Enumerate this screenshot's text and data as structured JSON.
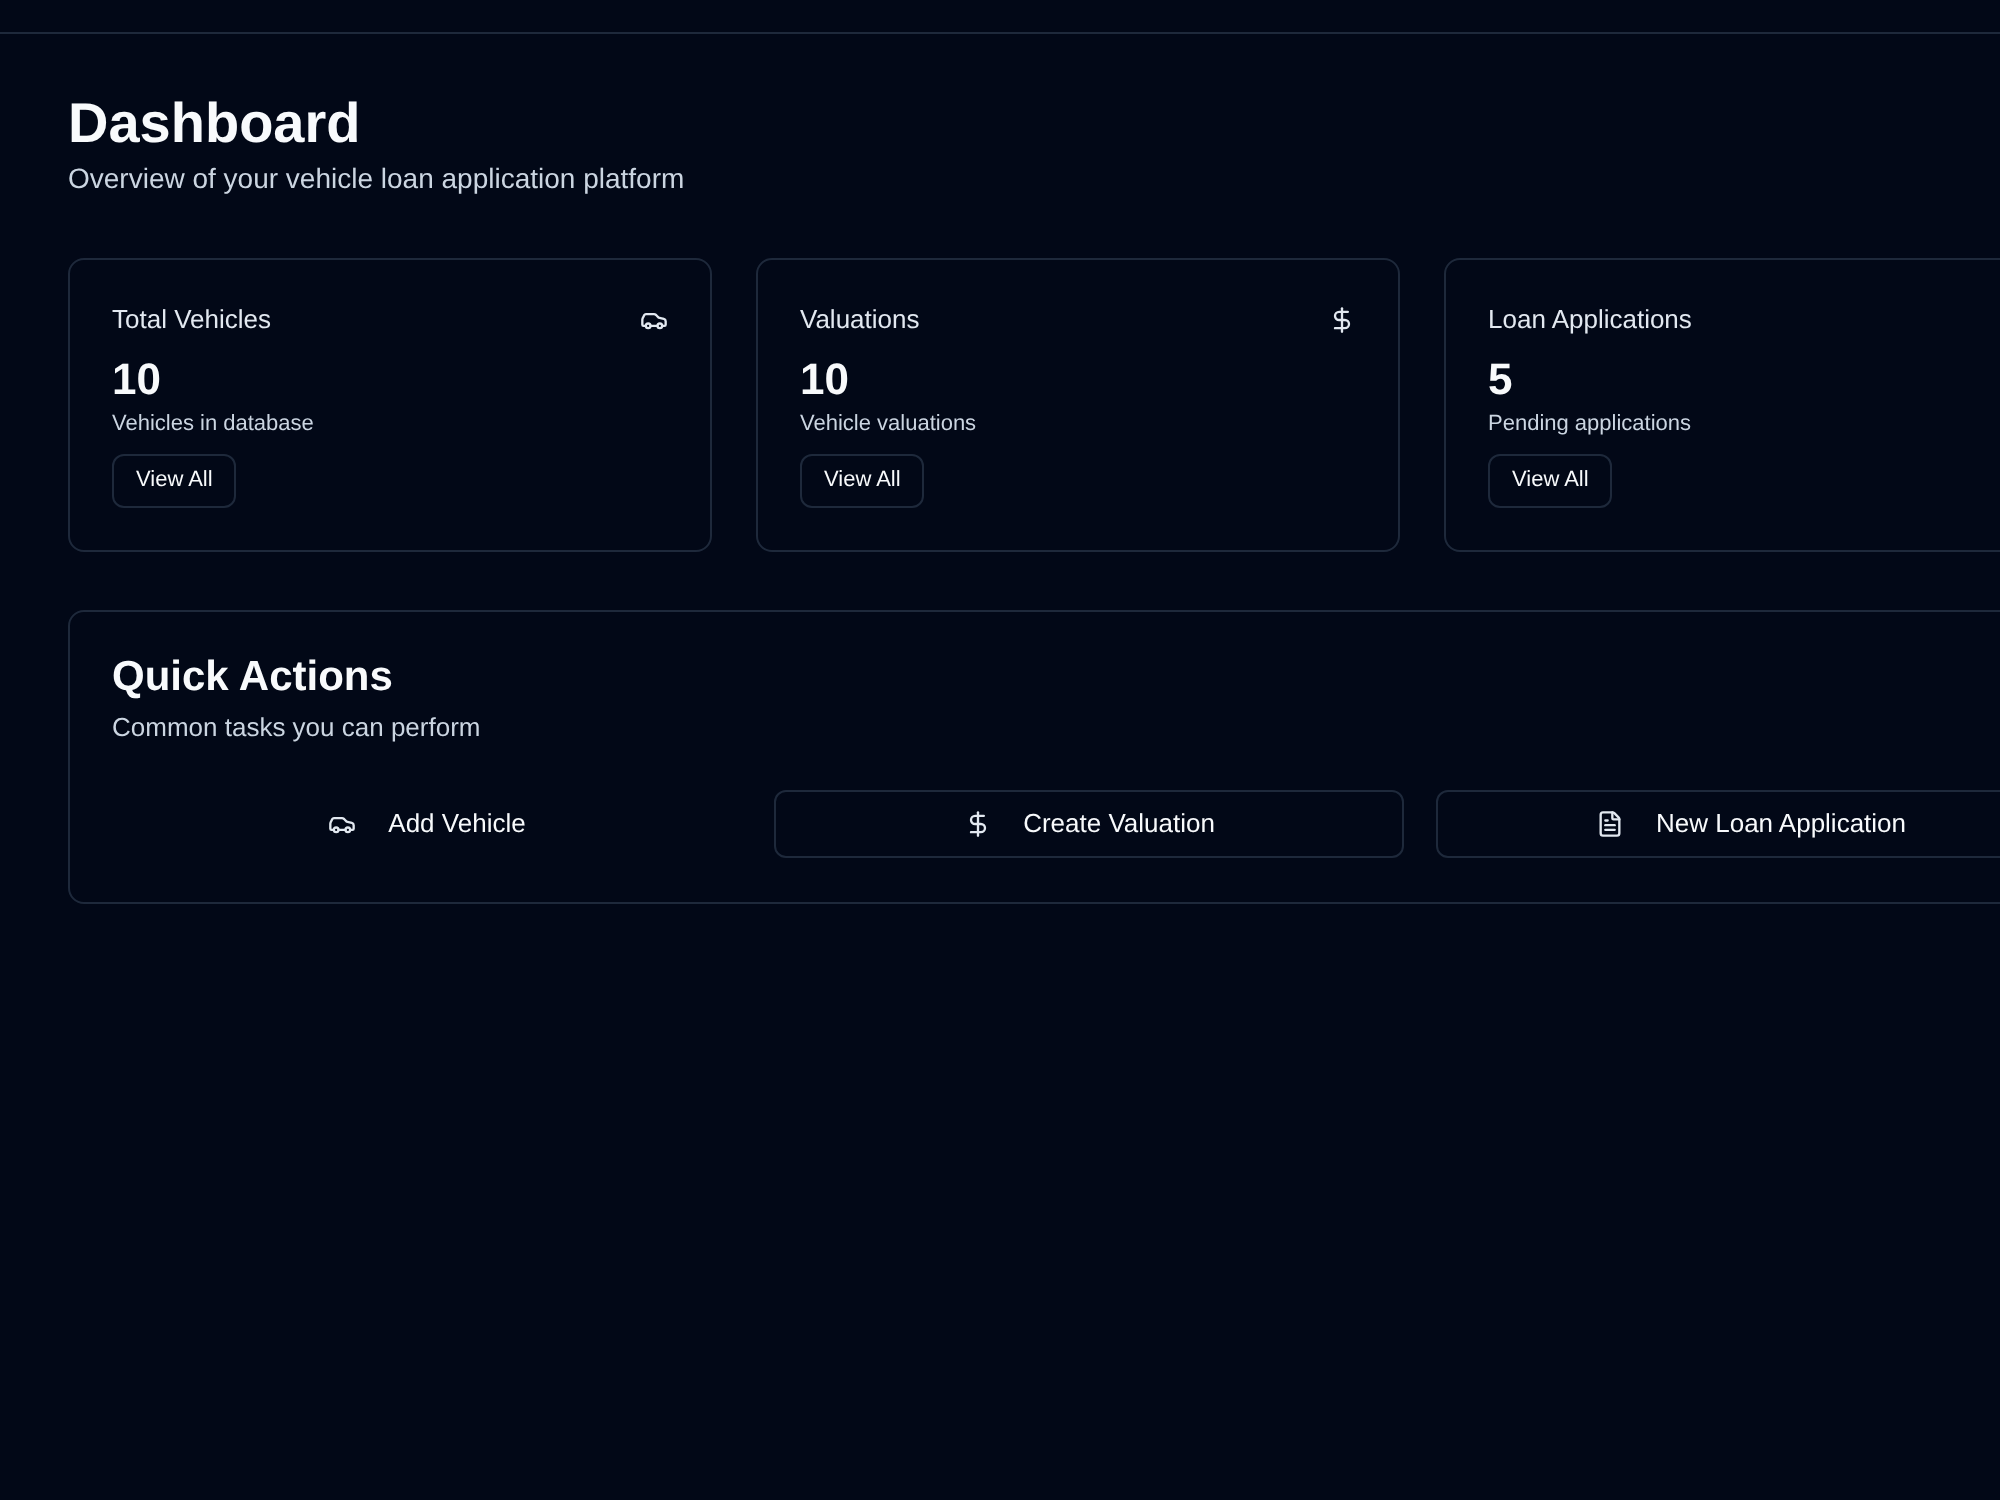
{
  "page": {
    "title": "Dashboard",
    "subtitle": "Overview of your vehicle loan application platform"
  },
  "stats": [
    {
      "kind": "vehicle",
      "title": "Total Vehicles",
      "value": "10",
      "caption": "Vehicles in database",
      "button": "View All"
    },
    {
      "kind": "valuation",
      "title": "Valuations",
      "value": "10",
      "caption": "Vehicle valuations",
      "button": "View All"
    },
    {
      "kind": "loan",
      "title": "Loan Applications",
      "value": "5",
      "caption": "Pending applications",
      "button": "View All"
    }
  ],
  "quick_actions": {
    "title": "Quick Actions",
    "subtitle": "Common tasks you can perform",
    "actions": [
      {
        "kind": "vehicle",
        "label": "Add Vehicle",
        "outlined": false
      },
      {
        "kind": "valuation",
        "label": "Create Valuation",
        "outlined": true
      },
      {
        "kind": "loan",
        "label": "New Loan Application",
        "outlined": true
      }
    ]
  }
}
